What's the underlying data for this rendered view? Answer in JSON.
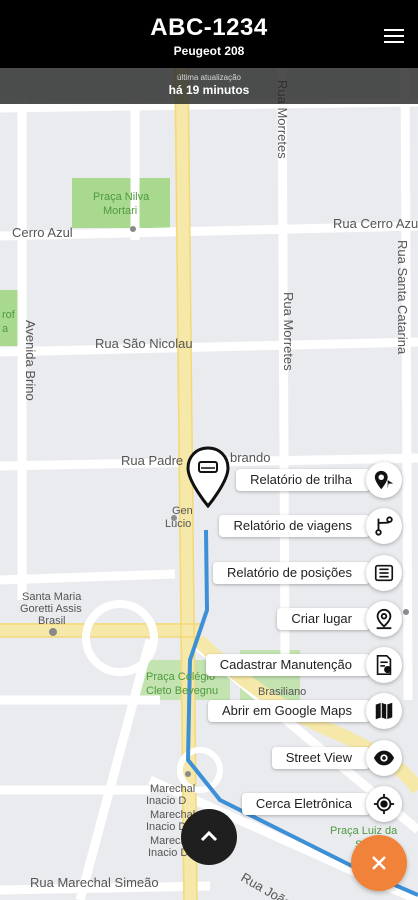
{
  "header": {
    "plate": "ABC-1234",
    "model": "Peugeot 208"
  },
  "update": {
    "label": "última atualização",
    "value": "há 19 minutos"
  },
  "map": {
    "streets": {
      "rua_morretes_top": "Rua Morretes",
      "rua_cerro_azul_left": "Cerro Azul",
      "rua_cerro_azul_right": "Rua Cerro Azul",
      "rua_santa_catarina": "Rua Santa Catarina",
      "rua_morretes_mid": "Rua Morretes",
      "avenida_brino": "Avenida Brino",
      "rua_sao_nicolau": "Rua São Nicolau",
      "rua_padre_agostinho": "Rua Padre",
      "rua_padre_agostinho_tail": "brando",
      "rua_marechal": "Rua Marechal Simeão",
      "rua_joao": "Rua João"
    },
    "parks": {
      "praca_nilva_1": "Praça Nilva",
      "praca_nilva_2": "Mortari",
      "roof_1": "rof",
      "roof_2": "a"
    },
    "pois": {
      "gen_1": "Gen",
      "gen_2": "Lucio",
      "santa_maria_1": "Santa Maria",
      "santa_maria_2": "Goretti Assis",
      "santa_maria_3": "Brasil",
      "praca_cleto_1": "Praça Colégio",
      "praca_cleto_2": "Cleto Bevegnu",
      "brasiliano": "Brasiliano",
      "marechal_1a": "Marechal",
      "marechal_1b": "Inacio D",
      "marechal_2a": "Marechal",
      "marechal_2b": "Inacio D",
      "marechal_3a": "Marechal Jose",
      "marechal_3b": "Inacio D",
      "praca_luiz_1": "Praça Luiz da",
      "praca_luiz_2": "Silva"
    }
  },
  "actions": [
    {
      "label": "Relatório de trilha",
      "icon": "route-pin-icon"
    },
    {
      "label": "Relatório de viagens",
      "icon": "fork-icon"
    },
    {
      "label": "Relatório de posições",
      "icon": "report-list-icon"
    },
    {
      "label": "Criar lugar",
      "icon": "place-pin-icon"
    },
    {
      "label": "Cadastrar Manutenção",
      "icon": "maintenance-doc-icon"
    },
    {
      "label": "Abrir em Google Maps",
      "icon": "map-icon"
    },
    {
      "label": "Street View",
      "icon": "eye-icon"
    },
    {
      "label": "Cerca Eletrônica",
      "icon": "target-icon"
    }
  ],
  "colors": {
    "header_bg": "#000000",
    "fab_orange": "#f0823a",
    "route_blue": "#3d8fd6",
    "park_green": "#a8d98f"
  }
}
